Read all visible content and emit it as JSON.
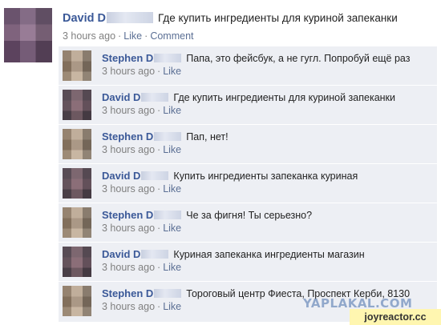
{
  "post": {
    "author": "David D",
    "message": "Где купить ингредиенты для куриной запеканки",
    "time": "3 hours ago",
    "like_label": "Like",
    "comment_label": "Comment"
  },
  "comments": [
    {
      "author": "Stephen D",
      "message": "Папа, это фейсбук, а не гугл. Попробуй ещё раз",
      "time": "3 hours ago",
      "like_label": "Like",
      "avatar": "stephen"
    },
    {
      "author": "David D",
      "message": "Где купить ингредиенты для куриной запеканки",
      "time": "3 hours ago",
      "like_label": "Like",
      "avatar": "david"
    },
    {
      "author": "Stephen D",
      "message": "Пап, нет!",
      "time": "3 hours ago",
      "like_label": "Like",
      "avatar": "stephen"
    },
    {
      "author": "David D",
      "message": "Купить ингредиенты запеканка куриная",
      "time": "3 hours ago",
      "like_label": "Like",
      "avatar": "david"
    },
    {
      "author": "Stephen D",
      "message": "Че за фигня! Ты серьезно?",
      "time": "3 hours ago",
      "like_label": "Like",
      "avatar": "stephen"
    },
    {
      "author": "David D",
      "message": "Куриная запеканка ингредиенты магазин",
      "time": "3 hours ago",
      "like_label": "Like",
      "avatar": "david"
    },
    {
      "author": "Stephen D",
      "message": "Тороговый центр Фиеста, Проспект Керби, 8130",
      "time": "3 hours ago",
      "like_label": "Like",
      "avatar": "stephen"
    }
  ],
  "watermarks": {
    "yaplakal": "YAPLAKAL.COM",
    "joyreactor": "joyreactor.cc"
  },
  "colors": {
    "author_link": "#3b5998",
    "comment_bg": "#edeff4",
    "meta_gray": "#808080"
  }
}
